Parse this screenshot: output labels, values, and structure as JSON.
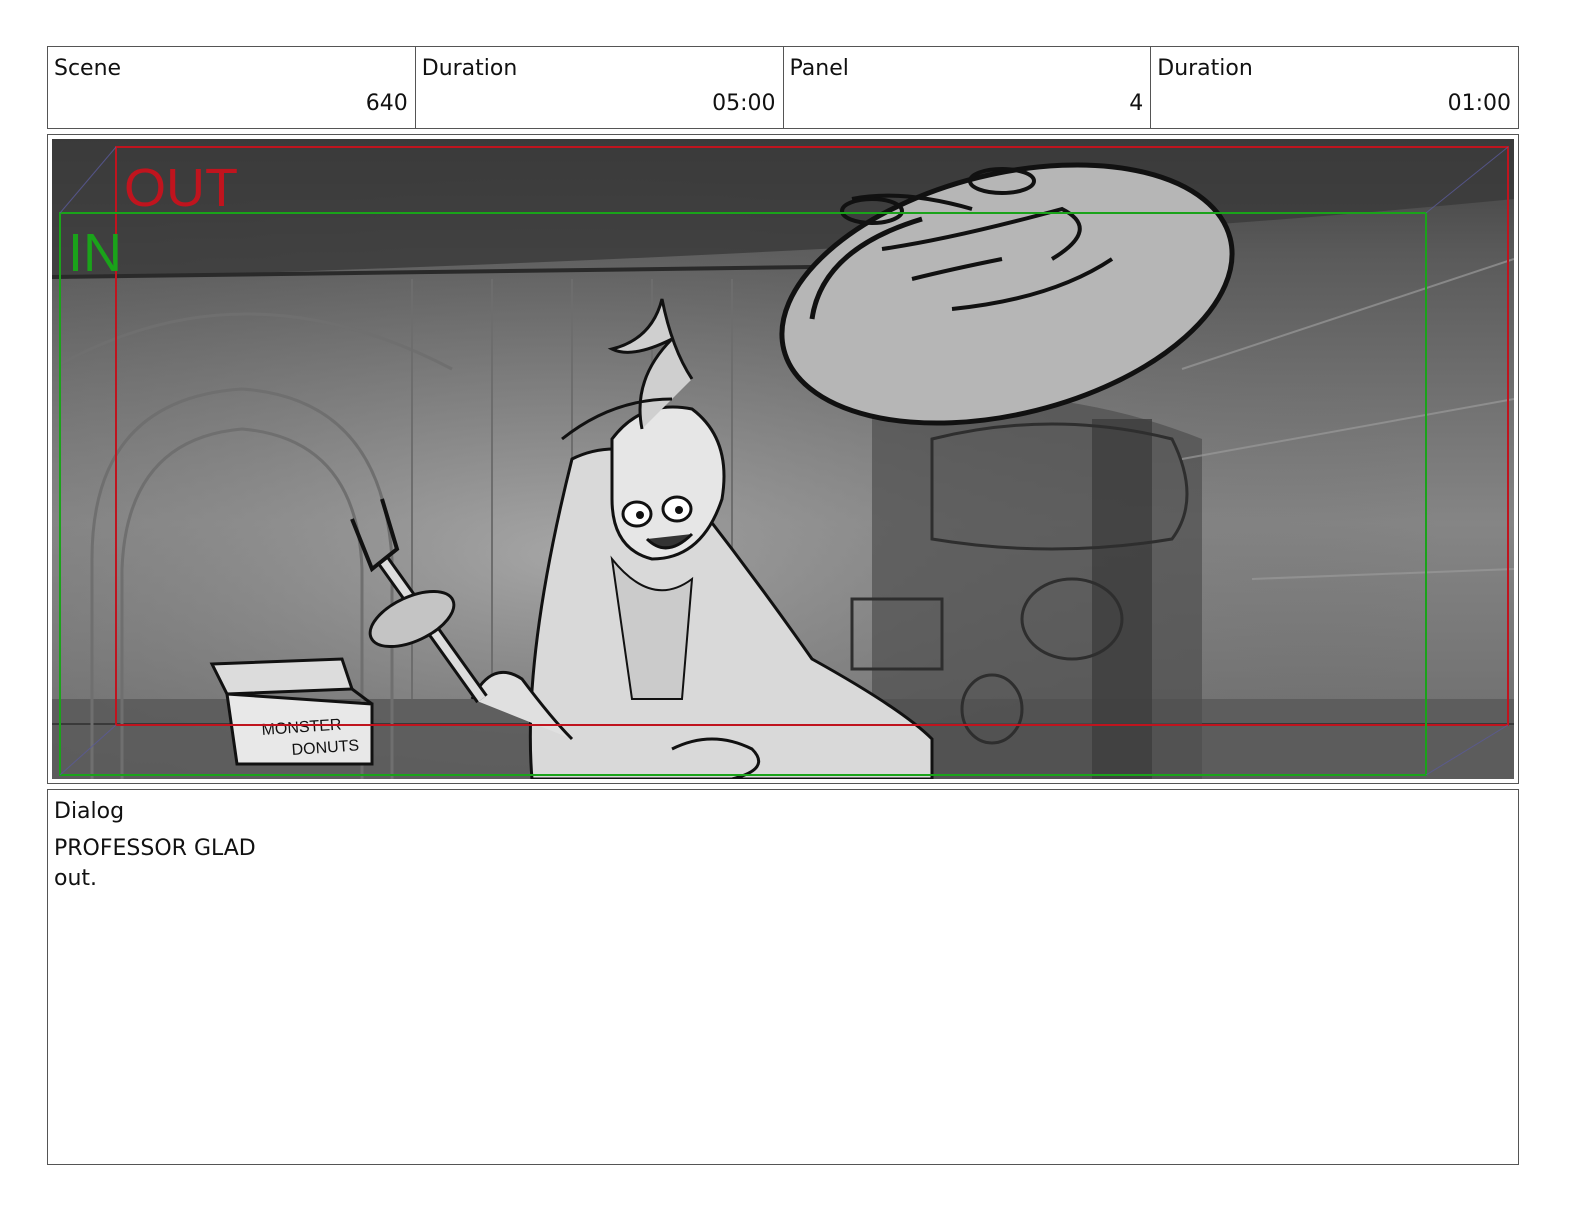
{
  "header": {
    "scene_label": "Scene",
    "scene_value": "640",
    "scene_duration_label": "Duration",
    "scene_duration_value": "05:00",
    "panel_label": "Panel",
    "panel_value": "4",
    "panel_duration_label": "Duration",
    "panel_duration_value": "01:00"
  },
  "panel": {
    "out_label": "OUT",
    "in_label": "IN",
    "box_text_line1": "MONSTER",
    "box_text_line2": "DONUTS",
    "colors": {
      "out_frame": "#c0141e",
      "in_frame": "#1aa31a",
      "background_dark": "#4a4a4a",
      "background_mid": "#8a8a8a"
    }
  },
  "dialog": {
    "label": "Dialog",
    "character": "PROFESSOR GLAD",
    "line": "out."
  }
}
